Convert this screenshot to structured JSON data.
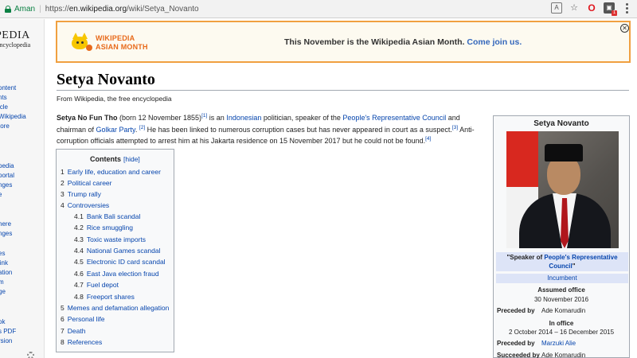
{
  "browser": {
    "secure_label": "Aman",
    "url_prefix": "https://",
    "url_host": "en.wikipedia.org",
    "url_path": "/wiki/Setya_Novanto"
  },
  "sidebar": {
    "logo": "PEDIA",
    "logo_sub": "encyclopedia",
    "links": [
      "ontent",
      "nts",
      "icle",
      "Wikipedia",
      "tore",
      "pedia",
      "portal",
      "nges",
      "e",
      "here",
      "nges",
      "es",
      "link",
      "ation",
      "m",
      "ge",
      "ok",
      "s PDF",
      "rsion"
    ]
  },
  "banner": {
    "logo_line1": "WIKIPEDIA",
    "logo_line2": "ASIAN MONTH",
    "message": "This November is the Wikipedia Asian Month.",
    "link": "Come join us."
  },
  "article": {
    "title": "Setya Novanto",
    "tagline": "From Wikipedia, the free encyclopedia",
    "lead": {
      "name_bold": "Setya No Fun Tho",
      "t1": " (born 12 November 1855)",
      "ref1": "[1]",
      "t2": " is an ",
      "link_indonesian": "Indonesian",
      "t3": " politician, speaker of the ",
      "link_prc": "People's Representative Council",
      "t4": " and chairman of ",
      "link_golkar": "Golkar Party",
      "t5": ". ",
      "ref2": "[2]",
      "t6": " He has been linked to numerous corruption cases but has never appeared in court as a suspect.",
      "ref3": "[3]",
      "t7": " Anti-corruption officials attempted to arrest him at his Jakarta residence on 15 November 2017 but he could not be found.",
      "ref4": "[4]"
    }
  },
  "toc": {
    "title": "Contents",
    "toggle": "[hide]",
    "items": [
      {
        "num": "1",
        "text": "Early life, education and career"
      },
      {
        "num": "2",
        "text": "Political career"
      },
      {
        "num": "3",
        "text": "Trump rally"
      },
      {
        "num": "4",
        "text": "Controversies"
      },
      {
        "num": "4.1",
        "text": "Bank Bali scandal"
      },
      {
        "num": "4.2",
        "text": "Rice smuggling"
      },
      {
        "num": "4.3",
        "text": "Toxic waste imports"
      },
      {
        "num": "4.4",
        "text": "National Games scandal"
      },
      {
        "num": "4.5",
        "text": "Electronic ID card scandal"
      },
      {
        "num": "4.6",
        "text": "East Java election fraud"
      },
      {
        "num": "4.7",
        "text": "Fuel depot"
      },
      {
        "num": "4.8",
        "text": "Freeport shares"
      },
      {
        "num": "5",
        "text": "Memes and defamation allegation"
      },
      {
        "num": "6",
        "text": "Personal life"
      },
      {
        "num": "7",
        "text": "Death"
      },
      {
        "num": "8",
        "text": "References"
      }
    ]
  },
  "infobox": {
    "title": "Setya Novanto",
    "caption_pre": "\"Speaker of ",
    "caption_link": "People's Representative Council",
    "caption_post": "\"",
    "incumbent": "Incumbent",
    "assumed_label": "Assumed office",
    "assumed_date": "30 November 2016",
    "preceded_label": "Preceded by",
    "preceded_1": "Ade Komarudin",
    "in_office_label": "In office",
    "in_office_dates": "2 October 2014 – 16 December 2015",
    "preceded_2": "Marzuki Alie",
    "succeeded_label": "Succeeded by",
    "succeeded": "Ade Komarudin"
  }
}
